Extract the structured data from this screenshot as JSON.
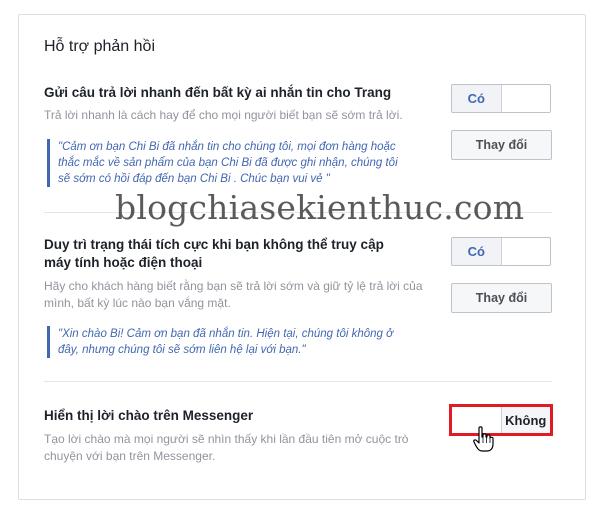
{
  "section": {
    "title": "Hỗ trợ phản hồi"
  },
  "instant_reply": {
    "heading": "Gửi câu trả lời nhanh đến bất kỳ ai nhắn tin cho Trang",
    "description": "Trả lời nhanh là cách hay để cho mọi người biết bạn sẽ sớm trả lời.",
    "quote_line1": "\"Cảm ơn bạn Chi Bi đã nhắn tin cho chúng tôi, mọi đơn hàng hoặc",
    "quote_line2": "thắc mắc về sản phẩm của bạn Chi Bi đã được ghi nhận, chúng tôi",
    "quote_line3": "sẽ sớm có hồi đáp đến bạn Chi Bi . Chúc bạn vui vẻ \"",
    "toggle_on": "Có",
    "toggle_off": "",
    "change_label": "Thay đổi"
  },
  "away_status": {
    "heading_line1": "Duy trì trạng thái tích cực khi bạn không thể truy cập",
    "heading_line2": "máy tính hoặc điện thoại",
    "description_line1": "Hãy cho khách hàng biết rằng bạn sẽ trả lời sớm và giữ tỷ lệ trả lời của",
    "description_line2": "mình, bất kỳ lúc nào bạn vắng mặt.",
    "quote_line1": "\"Xin chào Bi! Cảm ơn bạn đã nhắn tin. Hiện tại, chúng tôi không ở",
    "quote_line2": "đây, nhưng chúng tôi sẽ sớm liên hệ lại với bạn.\"",
    "toggle_on": "Có",
    "change_label": "Thay đổi"
  },
  "greeting": {
    "heading": "Hiển thị lời chào trên Messenger",
    "description_line1": "Tạo lời chào mà mọi người sẽ nhìn thấy khi lần đầu tiên mở cuộc trò",
    "description_line2": "chuyện với bạn trên Messenger.",
    "toggle_off": "Không"
  },
  "watermark": "blogchiasekienthuc.com",
  "colors": {
    "accent": "#4267b2",
    "highlight": "#e01b24"
  }
}
